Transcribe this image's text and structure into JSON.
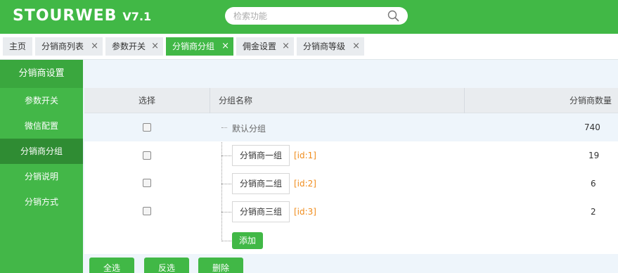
{
  "app": {
    "logo": "STOURWEB",
    "version": "V7.1"
  },
  "search": {
    "placeholder": "检索功能"
  },
  "tabs": [
    {
      "label": "主页",
      "closable": false,
      "active": false
    },
    {
      "label": "分销商列表",
      "closable": true,
      "active": false
    },
    {
      "label": "参数开关",
      "closable": true,
      "active": false
    },
    {
      "label": "分销商分组",
      "closable": true,
      "active": true
    },
    {
      "label": "佣金设置",
      "closable": true,
      "active": false
    },
    {
      "label": "分销商等级",
      "closable": true,
      "active": false
    }
  ],
  "tab_close_glyph": "×",
  "sidebar": {
    "title": "分销商设置",
    "items": [
      {
        "label": "参数开关",
        "active": false
      },
      {
        "label": "微信配置",
        "active": false
      },
      {
        "label": "分销商分组",
        "active": true
      },
      {
        "label": "分销说明",
        "active": false
      },
      {
        "label": "分销方式",
        "active": false
      }
    ]
  },
  "table": {
    "headers": {
      "select": "选择",
      "group_name": "分组名称",
      "count": "分销商数量"
    },
    "default_row": {
      "name": "默认分组",
      "count": "740"
    },
    "rows": [
      {
        "name": "分销商一组",
        "id": "[id:1]",
        "count": "19"
      },
      {
        "name": "分销商二组",
        "id": "[id:2]",
        "count": "6"
      },
      {
        "name": "分销商三组",
        "id": "[id:3]",
        "count": "2"
      }
    ],
    "add_label": "添加"
  },
  "footer": {
    "select_all": "全选",
    "invert": "反选",
    "delete": "删除"
  },
  "colors": {
    "brand_green": "#41b846",
    "id_orange": "#f08c1c"
  }
}
